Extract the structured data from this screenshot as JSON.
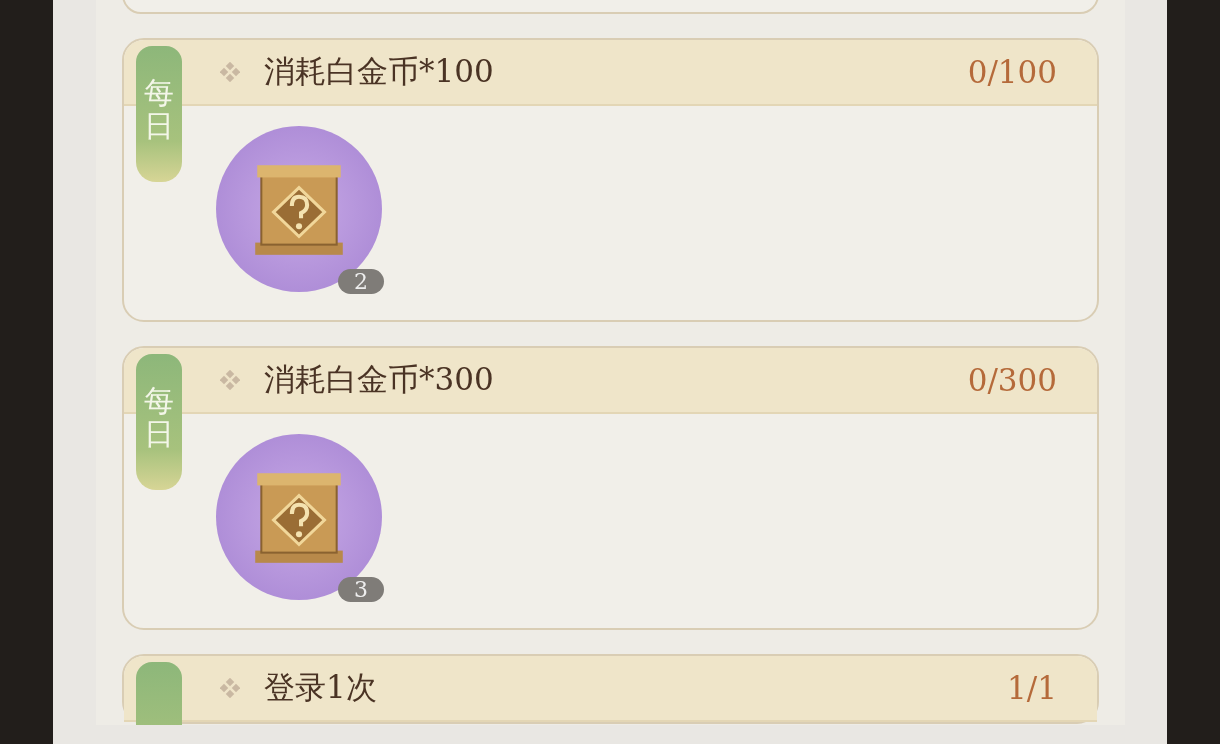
{
  "tasks": [
    {
      "tag": "每日",
      "title": "消耗白金币*100",
      "progress": "0/100",
      "rewards": [
        {
          "count": "2"
        }
      ]
    },
    {
      "tag": "每日",
      "title": "消耗白金币*300",
      "progress": "0/300",
      "rewards": [
        {
          "count": "3"
        }
      ]
    },
    {
      "title": "登录1次",
      "progress": "1/1"
    }
  ]
}
